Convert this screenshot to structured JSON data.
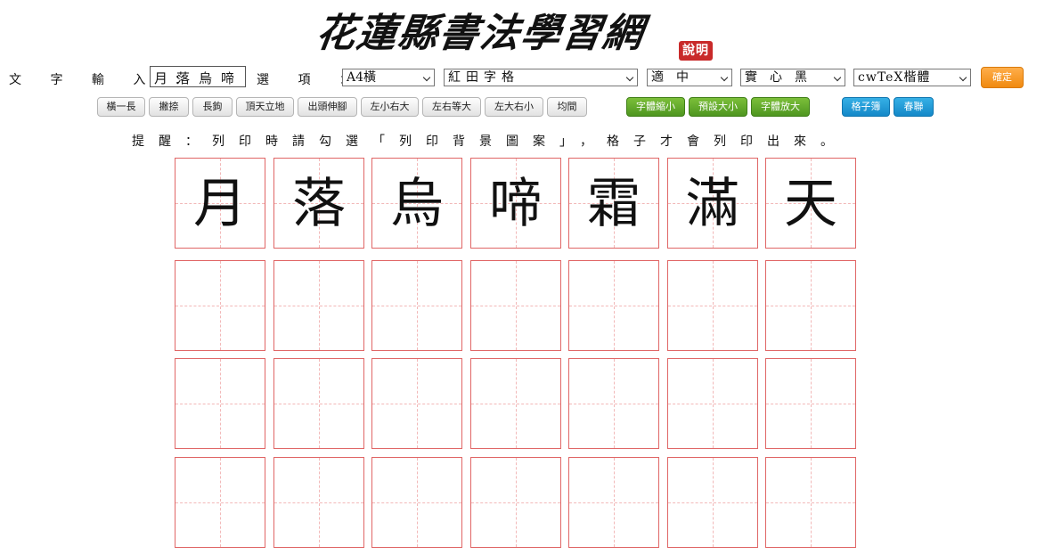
{
  "header": {
    "title": "花蓮縣書法學習網",
    "seal": "說明"
  },
  "form": {
    "text_label": "文 字 輸 入 ：",
    "text_value": "月落烏啼",
    "option_label": "選 項 ：",
    "paper_select": "A4橫",
    "grid_select": "紅田字格",
    "size_select": "適中",
    "style_select": "實心黑",
    "font_select": "cwTeX楷體",
    "ok_button": "確定"
  },
  "stroke_buttons": [
    "橫一長",
    "撇捺",
    "長鉤",
    "頂天立地",
    "出頭伸腳",
    "左小右大",
    "左右等大",
    "左大右小",
    "均間"
  ],
  "size_buttons": [
    "字體縮小",
    "預設大小",
    "字體放大"
  ],
  "extra_buttons": [
    "格子簿",
    "春聯"
  ],
  "hint": "提醒：列印時請勾選「列印背景圖案」，格子才會列印出來。",
  "grid": {
    "characters": [
      "月",
      "落",
      "烏",
      "啼",
      "霜",
      "滿",
      "天"
    ]
  },
  "colors": {
    "grid_border": "#e06666",
    "grid_guide": "#f2b8b8",
    "ok_button": "#f08a10",
    "green_button": "#4e9620",
    "blue_button": "#1488c8"
  }
}
